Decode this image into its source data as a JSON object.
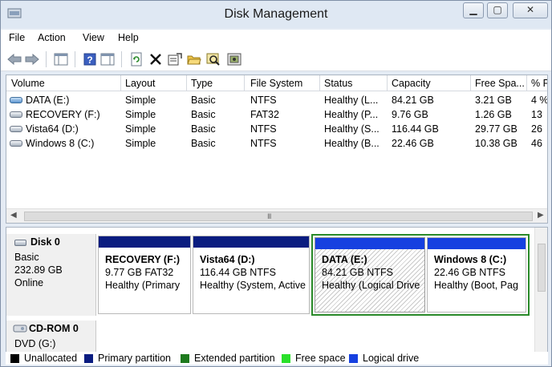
{
  "window": {
    "title": "Disk Management",
    "min_glyph": "▁",
    "max_glyph": "▢",
    "close_glyph": "✕"
  },
  "menu": [
    "File",
    "Action",
    "View",
    "Help"
  ],
  "toolbar": {
    "icons": [
      "back-arrow-icon",
      "forward-arrow-icon",
      "show-hide-console-tree-icon",
      "help-icon",
      "show-hide-action-pane-icon",
      "refresh-icon",
      "delete-icon",
      "properties-icon",
      "open-icon",
      "explore-icon",
      "rescan-disks-icon"
    ]
  },
  "columns": [
    "Volume",
    "Layout",
    "Type",
    "File System",
    "Status",
    "Capacity",
    "Free Spa...",
    "% F"
  ],
  "volumes": [
    {
      "volume": "DATA (E:)",
      "layout": "Simple",
      "type": "Basic",
      "fs": "NTFS",
      "status": "Healthy (L...",
      "capacity": "84.21 GB",
      "free": "3.21 GB",
      "pct": "4 %",
      "icon": "blue"
    },
    {
      "volume": "RECOVERY (F:)",
      "layout": "Simple",
      "type": "Basic",
      "fs": "FAT32",
      "status": "Healthy (P...",
      "capacity": "9.76 GB",
      "free": "1.26 GB",
      "pct": "13",
      "icon": "gray"
    },
    {
      "volume": "Vista64 (D:)",
      "layout": "Simple",
      "type": "Basic",
      "fs": "NTFS",
      "status": "Healthy (S...",
      "capacity": "116.44 GB",
      "free": "29.77 GB",
      "pct": "26",
      "icon": "gray"
    },
    {
      "volume": "Windows 8 (C:)",
      "layout": "Simple",
      "type": "Basic",
      "fs": "NTFS",
      "status": "Healthy (B...",
      "capacity": "22.46 GB",
      "free": "10.38 GB",
      "pct": "46",
      "icon": "gray"
    }
  ],
  "scroll_grip": "III",
  "disk0": {
    "name": "Disk 0",
    "type": "Basic",
    "size": "232.89 GB",
    "state": "Online",
    "partitions": [
      {
        "name": "RECOVERY  (F:)",
        "size_fs": "9.77 GB FAT32",
        "status": "Healthy (Primary",
        "bar_color": "#0a1c80"
      },
      {
        "name": "Vista64  (D:)",
        "size_fs": "116.44 GB NTFS",
        "status": "Healthy (System, Active",
        "bar_color": "#0a1c80"
      },
      {
        "name": "DATA  (E:)",
        "size_fs": "84.21 GB NTFS",
        "status": "Healthy (Logical Drive",
        "bar_color": "#1640e0"
      },
      {
        "name": "Windows 8  (C:)",
        "size_fs": "22.46 GB NTFS",
        "status": "Healthy (Boot, Pag",
        "bar_color": "#1640e0"
      }
    ]
  },
  "cdrom0": {
    "name": "CD-ROM 0",
    "drive": "DVD (G:)"
  },
  "legend": [
    {
      "label": "Unallocated",
      "color": "#000000"
    },
    {
      "label": "Primary partition",
      "color": "#0a1c80"
    },
    {
      "label": "Extended partition",
      "color": "#1e7a1e"
    },
    {
      "label": "Free space",
      "color": "#2ae02a"
    },
    {
      "label": "Logical drive",
      "color": "#1640e0"
    }
  ],
  "colors": {
    "extended_border": "#2a8a2a",
    "window_bg": "#e4ebf4"
  }
}
